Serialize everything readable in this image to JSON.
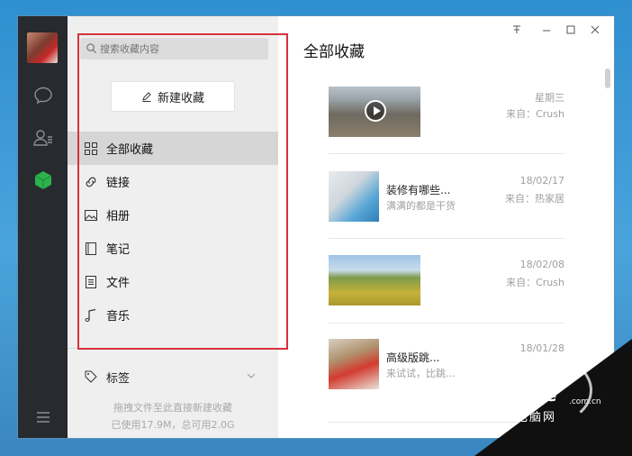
{
  "search": {
    "placeholder": "搜索收藏内容"
  },
  "sidebar": {
    "new_button": "新建收藏",
    "items": [
      {
        "label": "全部收藏",
        "icon": "grid-icon",
        "active": true
      },
      {
        "label": "链接",
        "icon": "link-icon"
      },
      {
        "label": "相册",
        "icon": "image-icon"
      },
      {
        "label": "笔记",
        "icon": "notebook-icon"
      },
      {
        "label": "文件",
        "icon": "file-icon"
      },
      {
        "label": "音乐",
        "icon": "music-icon"
      }
    ],
    "tags_label": "标签",
    "storage": {
      "line1": "拖拽文件至此直接新建收藏",
      "line2": "已使用17.9M，总可用2.0G"
    }
  },
  "main": {
    "title": "全部收藏",
    "items": [
      {
        "type": "video",
        "date": "星期三",
        "from": "来自：Crush"
      },
      {
        "type": "article",
        "title": "装修有哪些...",
        "subtitle": "满满的都是干货",
        "date": "18/02/17",
        "from": "来自：热家居"
      },
      {
        "type": "image",
        "date": "18/02/08",
        "from": "来自：Crush"
      },
      {
        "type": "article",
        "title": "高级版跳...",
        "subtitle": "来试试，比跳...",
        "date": "18/01/28"
      }
    ]
  },
  "window_controls": [
    "pin-icon",
    "minimize-icon",
    "maximize-icon",
    "close-icon"
  ],
  "watermark": {
    "logo": "PConline",
    "domain": ".com.cn",
    "sub": "太平洋电脑网"
  },
  "colors": {
    "navbar": "#272a2e",
    "sidebar": "#efefef",
    "active_item": "#d6d6d6",
    "annotation": "#d9303c",
    "accent_green": "#2bb24c"
  }
}
